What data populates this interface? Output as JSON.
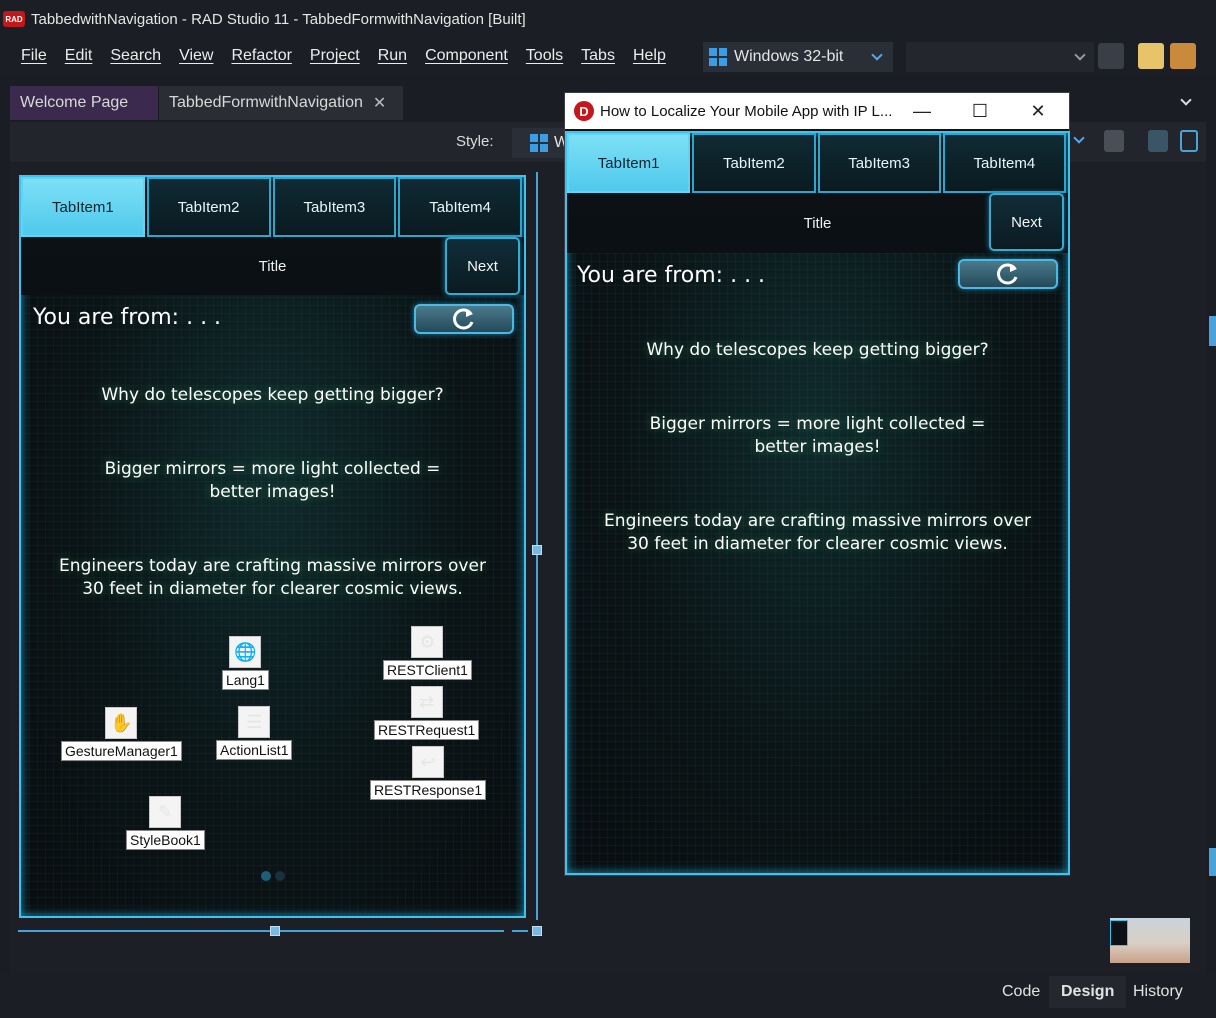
{
  "window": {
    "title": "TabbedwithNavigation - RAD Studio 11 - TabbedFormwithNavigation [Built]",
    "logo_text": "RAD"
  },
  "menu": [
    "File",
    "Edit",
    "Search",
    "View",
    "Refactor",
    "Project",
    "Run",
    "Component",
    "Tools",
    "Tabs",
    "Help"
  ],
  "toolbar": {
    "platform": "Windows 32-bit",
    "config": ""
  },
  "doc_tabs": {
    "welcome": "Welcome Page",
    "form": "TabbedFormwithNavigation",
    "close_glyph": "✕"
  },
  "style_bar": {
    "label": "Style:",
    "value": "Wi"
  },
  "form": {
    "tabs": [
      "TabItem1",
      "TabItem2",
      "TabItem3",
      "TabItem4"
    ],
    "toolbar_title": "Title",
    "next_label": "Next",
    "from_label": "You are from: . . .",
    "question": "Why do telescopes keep getting bigger?",
    "answer": "Bigger mirrors = more light collected = better images!",
    "detail": "Engineers today are crafting massive mirrors over 30 feet in diameter for clearer cosmic views."
  },
  "components": {
    "lang": "Lang1",
    "rest_client": "RESTClient1",
    "rest_request": "RESTRequest1",
    "rest_response": "RESTResponse1",
    "gesture": "GestureManager1",
    "action_list": "ActionList1",
    "stylebook": "StyleBook1"
  },
  "float_window": {
    "title": "How to Localize Your Mobile App with IP L...",
    "logo": "D"
  },
  "bottom_tabs": {
    "code": "Code",
    "design": "Design",
    "history": "History"
  },
  "colors": {
    "accent": "#3ec3f0",
    "active_tab": "#63d3f3",
    "app_red": "#c0181b"
  }
}
